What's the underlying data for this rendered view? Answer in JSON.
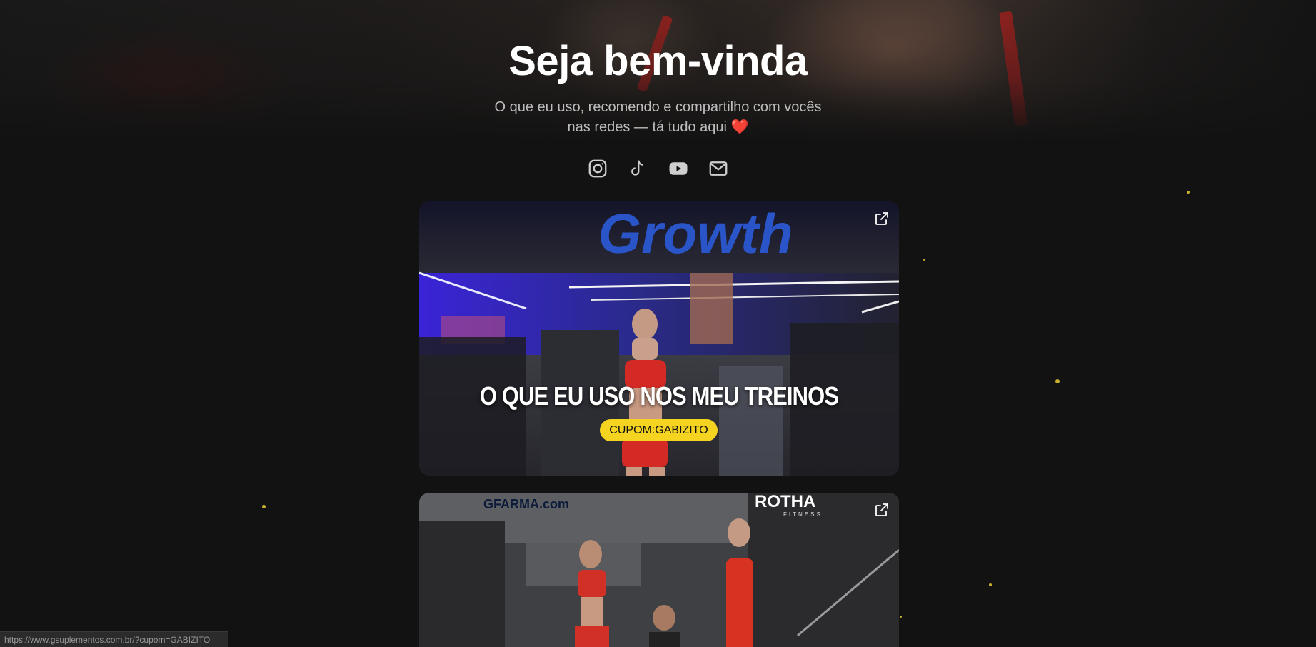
{
  "hero": {
    "title": "Seja bem-vinda",
    "subtitle_line1": "O que eu uso, recomendo e compartilho com vocês",
    "subtitle_line2": "nas redes — tá tudo aqui",
    "heart": "❤️"
  },
  "socials": [
    {
      "icon": "instagram-icon"
    },
    {
      "icon": "tiktok-icon"
    },
    {
      "icon": "youtube-icon"
    },
    {
      "icon": "mail-icon"
    }
  ],
  "cards": [
    {
      "brand_logo": "Growth",
      "heading": "O QUE EU USO NOS MEU TREINOS",
      "coupon": "CUPOM:GABIZITO",
      "icon": "external-link-icon"
    },
    {
      "brand_logo_left": "GFARMA.com",
      "brand_logo_right": "ROTHA",
      "brand_logo_right_sub": "FITNESS",
      "icon": "external-link-icon"
    }
  ],
  "status_bar": {
    "url": "https://www.gsuplementos.com.br/?cupom=GABIZITO"
  },
  "colors": {
    "background": "#121212",
    "coupon_bg": "#f5d321",
    "heart": "#e0242c",
    "accent_red": "#c8221e"
  }
}
